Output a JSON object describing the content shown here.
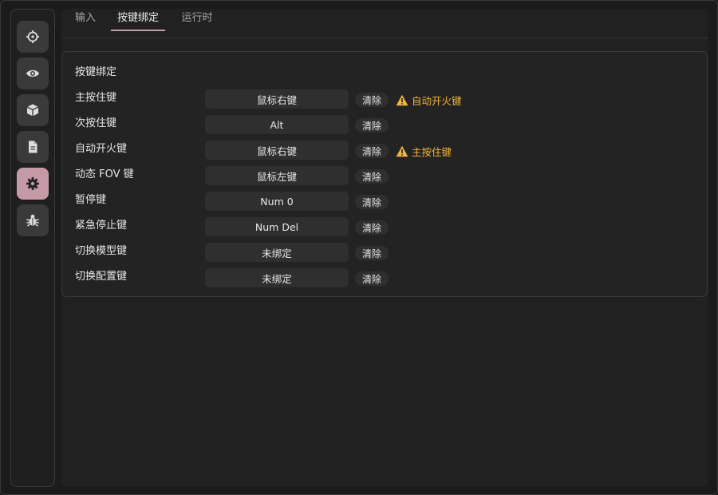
{
  "tabs": [
    {
      "label": "输入"
    },
    {
      "label": "按键绑定"
    },
    {
      "label": "运行时"
    }
  ],
  "active_tab": "按键绑定",
  "sidebar": {
    "items": [
      {
        "icon": "crosshair-icon"
      },
      {
        "icon": "eye-icon"
      },
      {
        "icon": "cube-icon"
      },
      {
        "icon": "document-icon"
      },
      {
        "icon": "gear-icon",
        "active": true
      },
      {
        "icon": "bug-icon"
      }
    ]
  },
  "card": {
    "title": "按键绑定",
    "clear_label": "清除",
    "rows": [
      {
        "label": "主按住键",
        "key": "鼠标右键",
        "conflict": "自动开火键"
      },
      {
        "label": "次按住键",
        "key": "Alt",
        "conflict": ""
      },
      {
        "label": "自动开火键",
        "key": "鼠标右键",
        "conflict": "主按住键"
      },
      {
        "label": "动态 FOV 键",
        "key": "鼠标左键",
        "conflict": ""
      },
      {
        "label": "暂停键",
        "key": "Num 0",
        "conflict": ""
      },
      {
        "label": "紧急停止键",
        "key": "Num Del",
        "conflict": ""
      },
      {
        "label": "切换模型键",
        "key": "未绑定",
        "conflict": ""
      },
      {
        "label": "切换配置键",
        "key": "未绑定",
        "conflict": ""
      }
    ]
  },
  "colors": {
    "accent": "#c59aa6",
    "warning": "#f0b63c",
    "background": "#1b1b1b",
    "panel": "#232323"
  }
}
